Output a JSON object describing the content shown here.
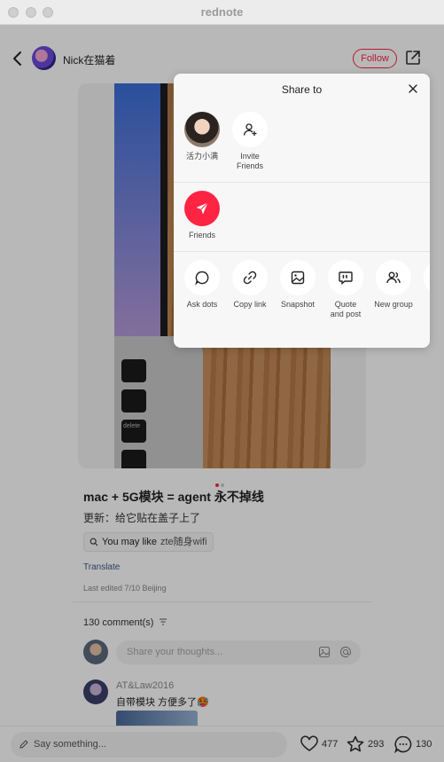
{
  "window": {
    "title": "rednote"
  },
  "header": {
    "author": "Nick在猫着",
    "follow_label": "Follow"
  },
  "post": {
    "title": "mac + 5G模块 = agent 永不掉线",
    "body": "更新：给它贴在盖子上了",
    "search_tag_label": "You may like",
    "search_tag_query": "zte随身wifi",
    "translate_label": "Translate",
    "edited": "Last edited 7/10 Beijing",
    "comments_count": "130 comment(s)",
    "comment_placeholder": "Share your thoughts...",
    "comment_user": "AT&Law2016",
    "comment_text": "自带模块 方便多了🥵",
    "keyboard_key_label": "delete"
  },
  "bottom_bar": {
    "say_placeholder": "Say something...",
    "likes": "477",
    "collects": "293",
    "comments": "130"
  },
  "share_sheet": {
    "title": "Share to",
    "contacts": [
      {
        "label": "活力小满"
      },
      {
        "label": "Invite\nFriends"
      }
    ],
    "friends_label": "Friends",
    "actions": [
      {
        "label": "Ask dots",
        "icon": "chat-bubble-icon"
      },
      {
        "label": "Copy link",
        "icon": "link-icon"
      },
      {
        "label": "Snapshot",
        "icon": "image-icon"
      },
      {
        "label": "Quote\nand post",
        "icon": "quote-icon"
      },
      {
        "label": "New group",
        "icon": "group-icon"
      }
    ]
  },
  "colors": {
    "accent": "#ff2442"
  }
}
